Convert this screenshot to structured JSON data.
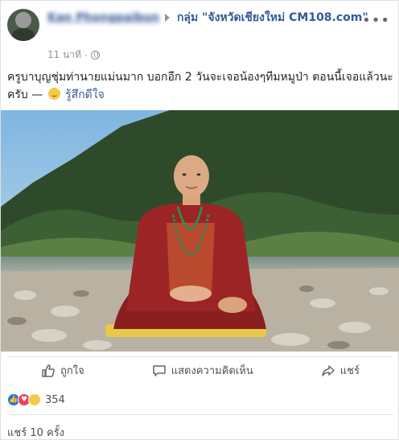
{
  "post": {
    "author": "Kan Phongpaibun",
    "group_name": "กลุ่ม \"จังหวัดเชียงใหม่ CM108.com\"",
    "timestamp": "11 นาที",
    "separator": "·",
    "text": "ครูบาบุญชุ่มท่านายแม่นมาก บอกอีก 2 วันจะเจอน้องๆทีมหมูป่า ตอนนี้เจอแล้วนะครับ —",
    "feeling": "รู้สึกดีใจ",
    "more_icon": "more-options-icon"
  },
  "actions": {
    "like_label": "ถูกใจ",
    "comment_label": "แสดงความคิดเห็น",
    "share_label": "แชร์"
  },
  "reactions": {
    "count": "354",
    "types": [
      "like",
      "love",
      "haha"
    ]
  },
  "shares_text": "แชร์ 10 ครั้ง",
  "colors": {
    "link": "#365899",
    "meta": "#90949c",
    "like": "#1877f2",
    "love": "#f33e58",
    "haha": "#f7c948"
  }
}
